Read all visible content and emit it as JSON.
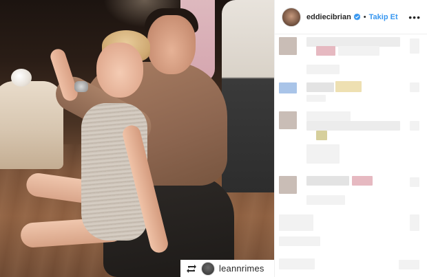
{
  "post": {
    "author": {
      "username": "eddiecibrian",
      "verified": true,
      "follow_label": "Takip Et",
      "separator": "•",
      "more_label": "•••"
    },
    "repost": {
      "username": "leannrimes",
      "icon": "repost-icon"
    },
    "colors": {
      "follow_blue": "#3897f0",
      "verified_blue": "#3897f0",
      "text": "#262626"
    }
  }
}
